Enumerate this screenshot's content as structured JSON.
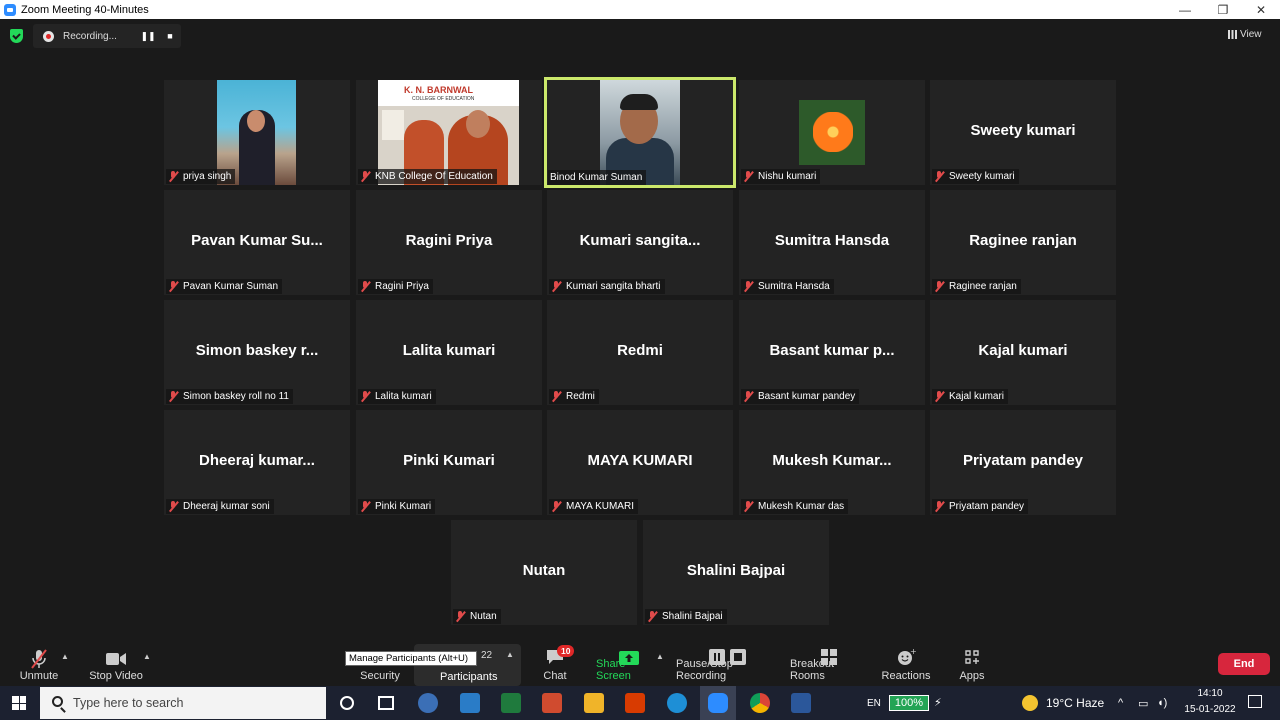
{
  "window": {
    "title": "Zoom Meeting 40-Minutes",
    "minimize": "—",
    "maximize": "❐",
    "close": "✕"
  },
  "recording": {
    "label": "Recording...",
    "pause": "❚❚",
    "stop": "■"
  },
  "view_label": "View",
  "tiles": [
    {
      "big": "",
      "cap": "priya singh",
      "video": true
    },
    {
      "big": "",
      "cap": "KNB College Of Education",
      "video": true
    },
    {
      "big": "",
      "cap": "Binod Kumar Suman",
      "video": true
    },
    {
      "big": "",
      "cap": "Nishu kumari",
      "video": true
    },
    {
      "big": "Sweety kumari",
      "cap": "Sweety kumari"
    },
    {
      "big": "Pavan Kumar Su...",
      "cap": "Pavan Kumar Suman"
    },
    {
      "big": "Ragini  Priya",
      "cap": "Ragini  Priya"
    },
    {
      "big": "Kumari  sangita...",
      "cap": "Kumari sangita bharti"
    },
    {
      "big": "Sumitra Hansda",
      "cap": "Sumitra Hansda"
    },
    {
      "big": "Raginee ranjan",
      "cap": "Raginee ranjan"
    },
    {
      "big": "Simon baskey r...",
      "cap": "Simon baskey roll no 11"
    },
    {
      "big": "Lalita kumari",
      "cap": "Lalita kumari"
    },
    {
      "big": "Redmi",
      "cap": "Redmi"
    },
    {
      "big": "Basant  kumar  p...",
      "cap": "Basant kumar pandey"
    },
    {
      "big": "Kajal kumari",
      "cap": "Kajal kumari"
    },
    {
      "big": "Dheeraj  kumar...",
      "cap": "Dheeraj kumar soni"
    },
    {
      "big": "Pinki Kumari",
      "cap": "Pinki Kumari"
    },
    {
      "big": "MAYA KUMARI",
      "cap": "MAYA KUMARI"
    },
    {
      "big": "Mukesh  Kumar...",
      "cap": "Mukesh Kumar das"
    },
    {
      "big": "Priyatam pandey",
      "cap": "Priyatam pandey"
    },
    {
      "big": "Nutan",
      "cap": "Nutan"
    },
    {
      "big": "Shalini Bajpai",
      "cap": "Shalini Bajpai"
    }
  ],
  "knb_banner": "K. N. BARNWAL",
  "knb_sub": "COLLEGE OF EDUCATION",
  "toolbar": {
    "unmute": "Unmute",
    "stop_video": "Stop Video",
    "security": "Security",
    "participants": "Participants",
    "participants_count": "22",
    "tooltip": "Manage Participants (Alt+U)",
    "chat": "Chat",
    "chat_badge": "10",
    "share_screen": "Share Screen",
    "pause_recording": "Pause/Stop Recording",
    "breakout_rooms": "Breakout Rooms",
    "reactions": "Reactions",
    "apps": "Apps",
    "end": "End"
  },
  "taskbar": {
    "search_placeholder": "Type here to search",
    "lang": "EN",
    "battery": "100%",
    "weather": "19°C  Haze",
    "time": "14:10",
    "date": "15-01-2022"
  },
  "colors": {
    "active_speaker": "#cbe86b",
    "share_green": "#23d959",
    "end_red": "#d7263d",
    "badge_red": "#e02828"
  }
}
